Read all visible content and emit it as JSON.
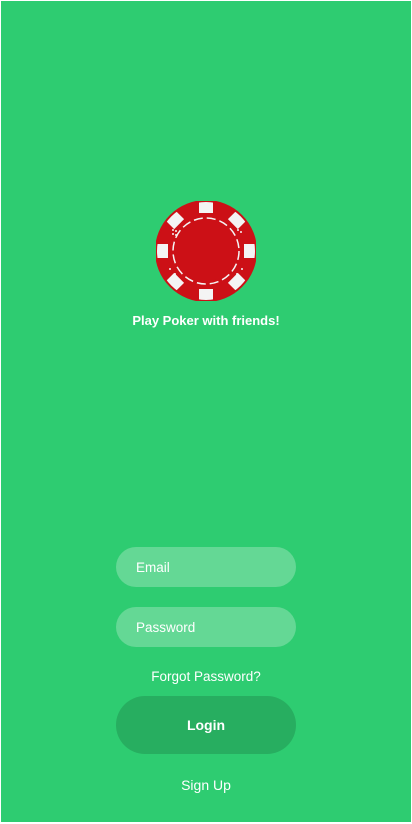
{
  "app": {
    "tagline": "Play Poker with friends!",
    "logo_icon": "poker-chip-icon"
  },
  "login_form": {
    "email_placeholder": "Email",
    "email_value": "",
    "password_placeholder": "Password",
    "password_value": "",
    "forgot_password_label": "Forgot Password?",
    "login_label": "Login",
    "signup_label": "Sign Up"
  },
  "colors": {
    "background": "#2ecc71",
    "input_fill": "#64d895",
    "button_fill": "#27ae60",
    "chip_red": "#cc1016",
    "text": "#ffffff"
  }
}
